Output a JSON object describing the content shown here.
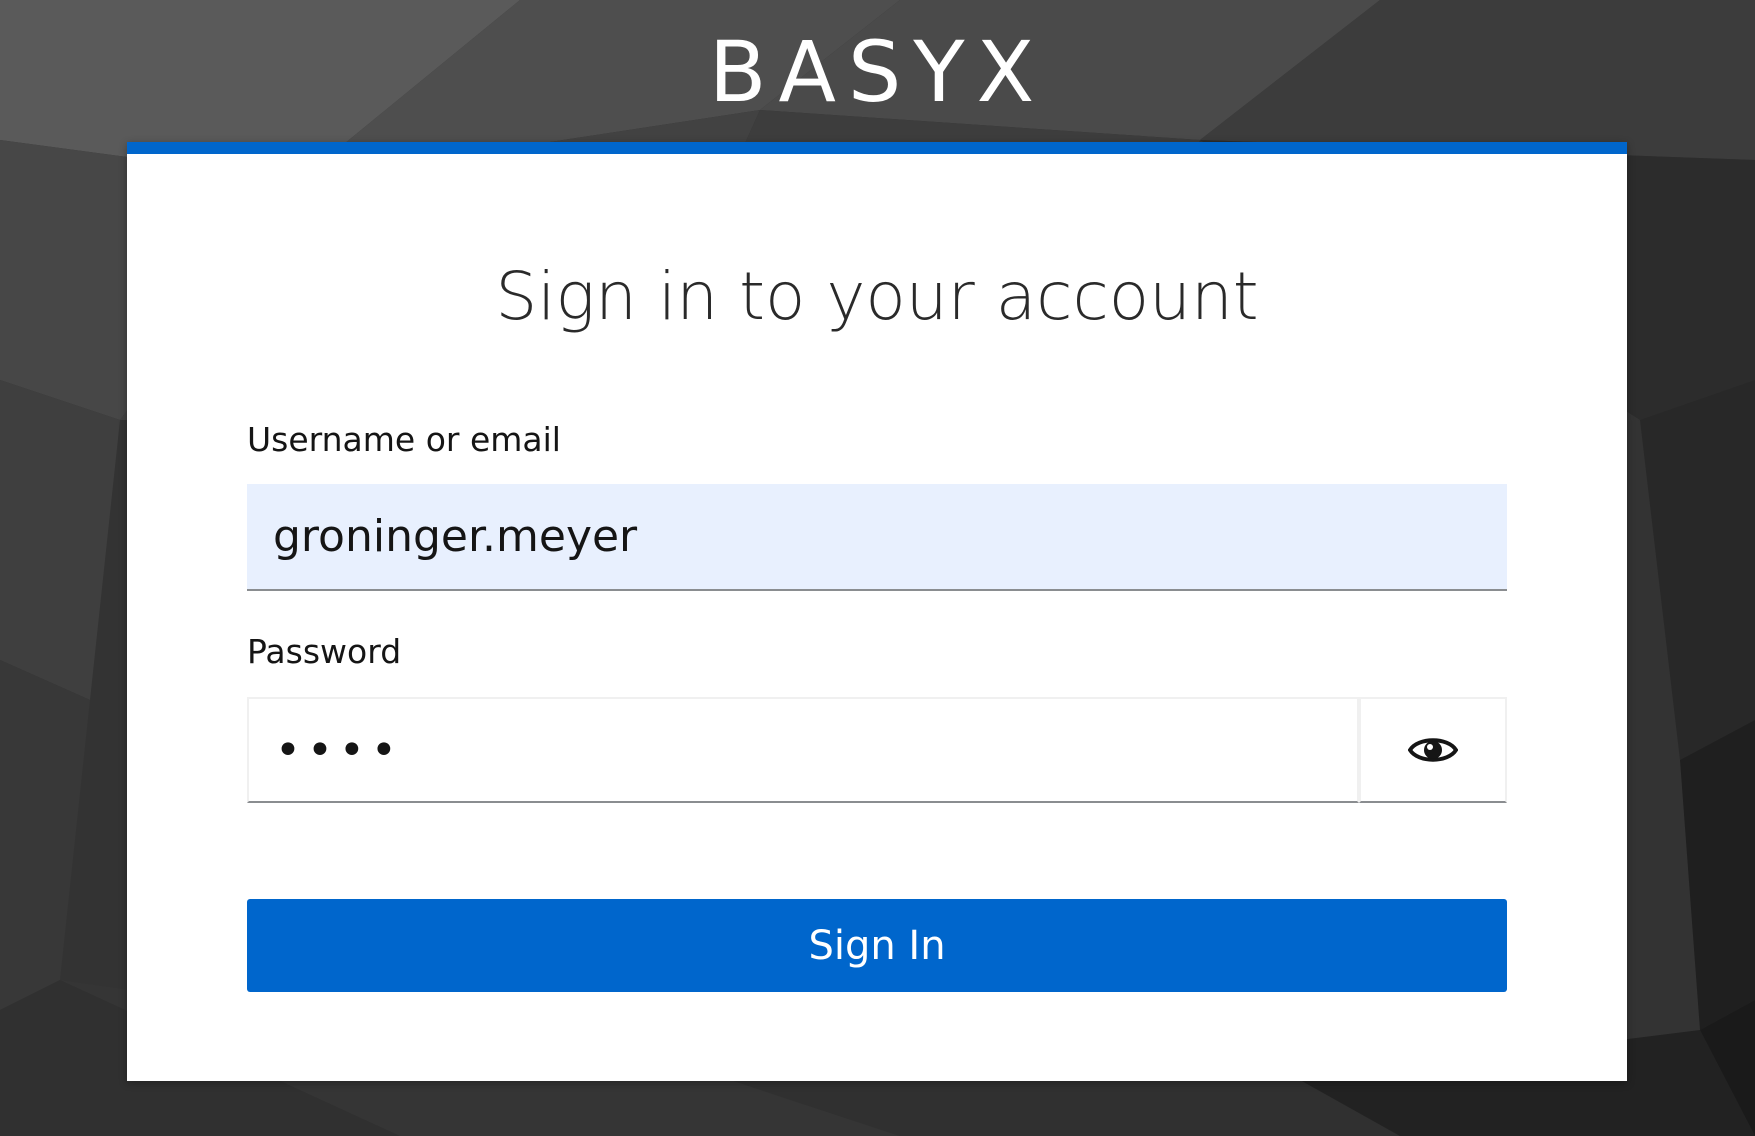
{
  "brand": {
    "title": "BASYX"
  },
  "card": {
    "title": "Sign in to your account"
  },
  "form": {
    "username_label": "Username or email",
    "username_value": "groninger.meyer",
    "password_label": "Password",
    "password_value": "••••",
    "show_password_icon": "eye-icon",
    "submit_label": "Sign In"
  },
  "colors": {
    "accent": "#0066cc",
    "autofill_bg": "#e8f0fe",
    "background": "#2e2e2e"
  }
}
